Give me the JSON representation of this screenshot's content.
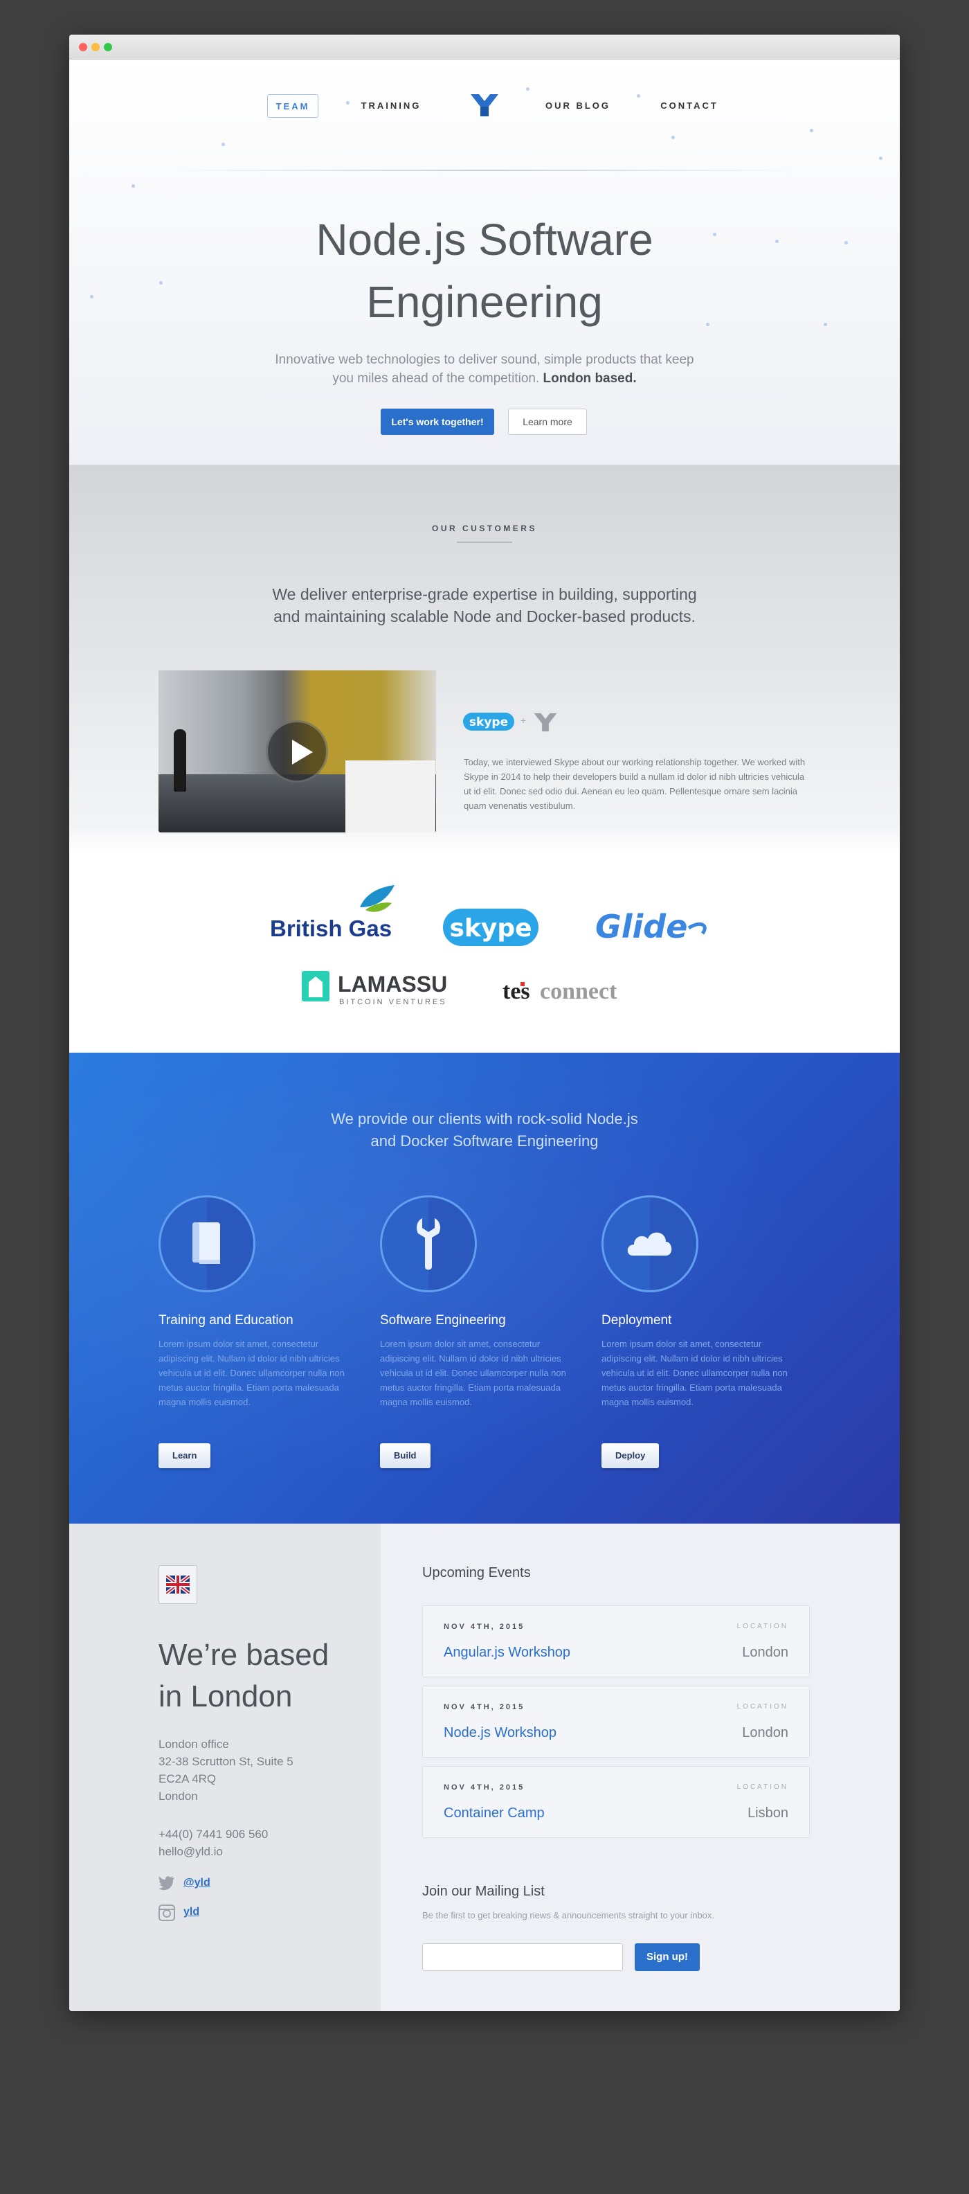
{
  "nav": {
    "items": [
      "TEAM",
      "TRAINING",
      "OUR BLOG",
      "CONTACT"
    ],
    "active": "TEAM"
  },
  "hero": {
    "title_line1": "Node.js Software",
    "title_line2": "Engineering",
    "lead": "Innovative web technologies to deliver sound, simple products that keep you miles ahead of the competition.",
    "lead_bold": "London based.",
    "primary_button": "Let's work together!",
    "secondary_button": "Learn more"
  },
  "customers": {
    "label": "OUR CUSTOMERS",
    "intro": "We deliver enterprise-grade expertise in building, supporting and maintaining scalable Node and Docker-based products.",
    "plus": "+",
    "quote": "Today, we interviewed Skype about our working relationship together. We worked with Skype in 2014 to help their developers build a nullam id dolor id nibh ultricies vehicula ut id elit. Donec sed odio dui. Aenean eu leo quam. Pellentesque ornare sem lacinia quam venenatis vestibulum.",
    "logos": {
      "british_gas": "British Gas",
      "skype": "skype",
      "glide": "Glide",
      "lamassu": "LAMASSU",
      "lamassu_sub": "BITCOIN VENTURES",
      "tesconnect_a": "tes",
      "tesconnect_b": "connect"
    }
  },
  "services": {
    "intro_line1": "We provide our clients with rock-solid Node.js",
    "intro_line2": "and Docker Software Engineering",
    "items": [
      {
        "title": "Training and Education",
        "body": "Lorem ipsum dolor sit amet, consectetur adipiscing elit. Nullam id dolor id nibh ultricies vehicula ut id elit. Donec ullamcorper nulla non metus auctor fringilla. Etiam porta malesuada magna mollis euismod.",
        "button": "Learn",
        "icon": "book-icon"
      },
      {
        "title": "Software Engineering",
        "body": "Lorem ipsum dolor sit amet, consectetur adipiscing elit. Nullam id dolor id nibh ultricies vehicula ut id elit. Donec ullamcorper nulla non metus auctor fringilla. Etiam porta malesuada magna mollis euismod.",
        "button": "Build",
        "icon": "wrench-icon"
      },
      {
        "title": "Deployment",
        "body": "Lorem ipsum dolor sit amet, consectetur adipiscing elit. Nullam id dolor id nibh ultricies vehicula ut id elit. Donec ullamcorper nulla non metus auctor fringilla. Etiam porta malesuada magna mollis euismod.",
        "button": "Deploy",
        "icon": "cloud-icon"
      }
    ]
  },
  "location": {
    "title_line1": "We’re based",
    "title_line2": "in London",
    "address": [
      "London office",
      "32-38 Scrutton St, Suite 5",
      "EC2A 4RQ",
      "London"
    ],
    "phone": "+44(0) 7441 906 560",
    "email": "hello@yld.io",
    "twitter": "@yld",
    "instagram": "yld"
  },
  "events": {
    "heading": "Upcoming Events",
    "location_label": "LOCATION",
    "items": [
      {
        "date": "NOV 4TH, 2015",
        "title": "Angular.js Workshop",
        "location": "London"
      },
      {
        "date": "NOV 4TH, 2015",
        "title": "Node.js Workshop",
        "location": "London"
      },
      {
        "date": "NOV 4TH, 2015",
        "title": "Container Camp",
        "location": "Lisbon"
      }
    ]
  },
  "mailing": {
    "heading": "Join our Mailing List",
    "subtitle": "Be the first to get breaking news & announcements straight to your inbox.",
    "input_placeholder": "",
    "button": "Sign up!"
  },
  "colors": {
    "accent": "#2a6fc9",
    "services_bg": "#2753c4",
    "page_bg": "#404040"
  }
}
